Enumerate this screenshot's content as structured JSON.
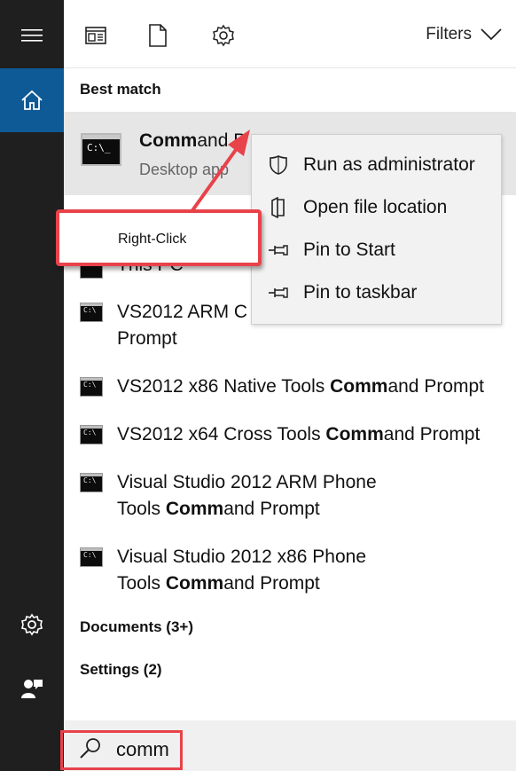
{
  "toolbar": {
    "filters_label": "Filters",
    "icons": [
      "apps-icon",
      "document-icon",
      "gear-icon"
    ]
  },
  "sections": {
    "best_match": "Best match",
    "documents": "Documents (3+)",
    "settings": "Settings (2)"
  },
  "best_match": {
    "title_bold": "Comm",
    "title_rest": "and P",
    "subtitle": "Desktop app"
  },
  "partial_result": "This PC",
  "results": [
    {
      "line1_pre": "VS2012 ARM C",
      "line1_bold": "",
      "line1_post": "",
      "line2_pre": "Prompt",
      "line2_bold": "",
      "line2_post": ""
    },
    {
      "line1_pre": "VS2012 x86 Native Tools ",
      "line1_bold": "Comm",
      "line1_post": "and Prompt",
      "line2_pre": "",
      "line2_bold": "",
      "line2_post": ""
    },
    {
      "line1_pre": "VS2012 x64 Cross Tools ",
      "line1_bold": "Comm",
      "line1_post": "and Prompt",
      "line2_pre": "",
      "line2_bold": "",
      "line2_post": ""
    },
    {
      "line1_pre": "Visual Studio 2012 ARM Phone",
      "line1_bold": "",
      "line1_post": "",
      "line2_pre": "Tools ",
      "line2_bold": "Comm",
      "line2_post": "and Prompt"
    },
    {
      "line1_pre": "Visual Studio 2012 x86 Phone",
      "line1_bold": "",
      "line1_post": "",
      "line2_pre": "Tools ",
      "line2_bold": "Comm",
      "line2_post": "and Prompt"
    }
  ],
  "context_menu": [
    {
      "label": "Run as administrator",
      "icon": "shield-icon"
    },
    {
      "label": "Open file location",
      "icon": "folder-icon"
    },
    {
      "label": "Pin to Start",
      "icon": "pin-icon"
    },
    {
      "label": "Pin to taskbar",
      "icon": "pin-icon"
    }
  ],
  "annotation": {
    "label": "Right-Click",
    "color": "#e8424a"
  },
  "search": {
    "value": "comm"
  },
  "colors": {
    "rail": "#1f1f1f",
    "active": "#0e5a96",
    "highlight": "#e6e6e6"
  }
}
